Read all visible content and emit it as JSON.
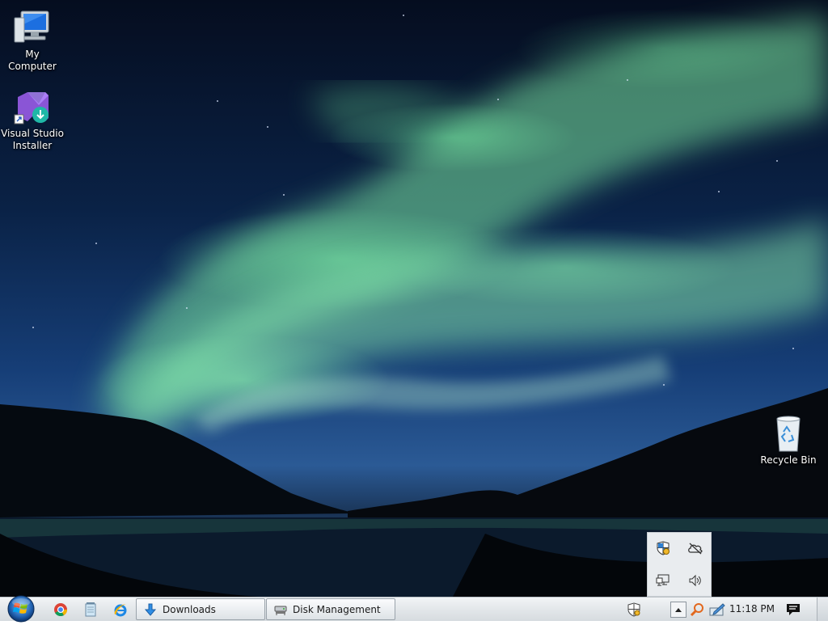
{
  "desktop": {
    "icons": [
      {
        "label": "My Computer"
      },
      {
        "label_line1": "Visual Studio",
        "label_line2": "Installer"
      },
      {
        "label": "Recycle Bin"
      }
    ]
  },
  "tray_popup": {
    "icons": [
      "security-shield-icon",
      "onedrive-offline-icon",
      "network-icon",
      "volume-icon"
    ]
  },
  "taskbar": {
    "start": "start-orb",
    "quick_launch": [
      "chrome-icon",
      "notepad-icon",
      "internet-explorer-icon"
    ],
    "buttons": [
      {
        "label": "Downloads",
        "icon": "download-arrow-icon"
      },
      {
        "label": "Disk Management",
        "icon": "disk-management-icon"
      }
    ],
    "tray": {
      "icons": [
        "action-center-flag-icon",
        "show-hidden-icons-arrow",
        "search-magnifier-icon",
        "pen-tablet-icon",
        "notification-icon"
      ],
      "clock": "11:18 PM"
    }
  },
  "colors": {
    "aurora_green": "#7fe6a6",
    "sky_top": "#050d1f",
    "taskbar_bg": "#e3e7ea"
  }
}
